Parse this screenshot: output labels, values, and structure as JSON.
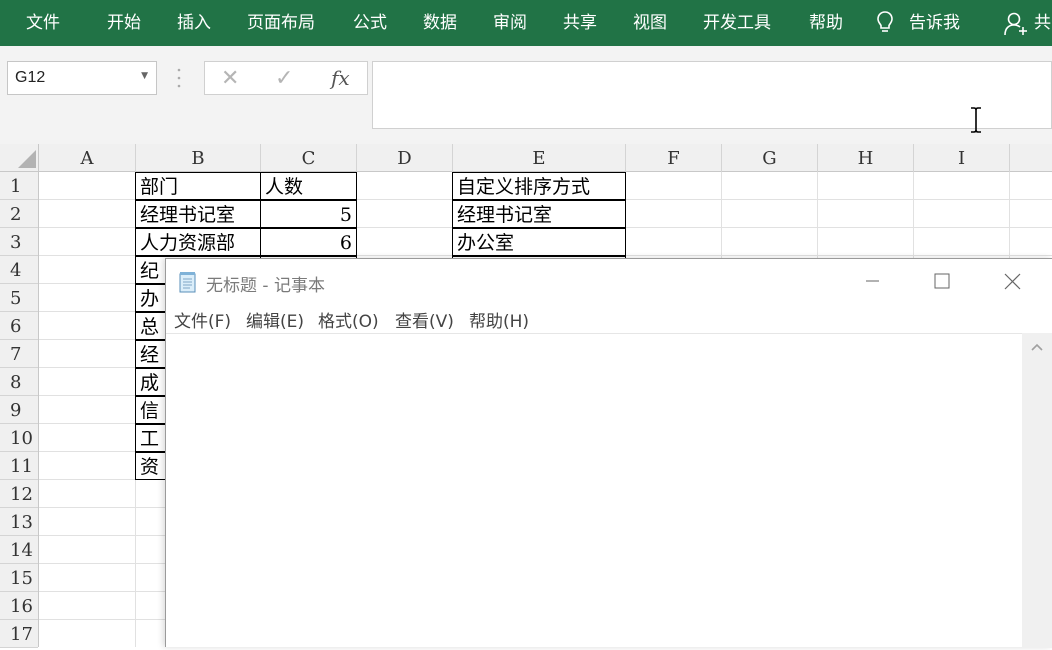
{
  "ribbon": {
    "tabs": [
      "文件",
      "开始",
      "插入",
      "页面布局",
      "公式",
      "数据",
      "审阅",
      "共享",
      "视图",
      "开发工具",
      "帮助"
    ],
    "tell_me": "告诉我",
    "share": "共"
  },
  "formula_bar": {
    "name_box": "G12",
    "fx_label": "fx",
    "cancel_symbol": "✕",
    "enter_symbol": "✓",
    "formula_value": ""
  },
  "grid": {
    "columns": [
      "A",
      "B",
      "C",
      "D",
      "E",
      "F",
      "G",
      "H",
      "I"
    ],
    "rows": [
      "1",
      "2",
      "3",
      "4",
      "5",
      "6",
      "7",
      "8",
      "9",
      "10",
      "11",
      "12",
      "13",
      "14",
      "15",
      "16",
      "17"
    ],
    "B": [
      "部门",
      "经理书记室",
      "人力资源部",
      "纪",
      "办",
      "总",
      "经",
      "成",
      "信",
      "工",
      "资"
    ],
    "C": [
      "人数",
      "5",
      "6"
    ],
    "E": [
      "自定义排序方式",
      "经理书记室",
      "办公室"
    ]
  },
  "notepad": {
    "title": "无标题 - 记事本",
    "menus": [
      "文件(F)",
      "编辑(E)",
      "格式(O)",
      "查看(V)",
      "帮助(H)"
    ],
    "content": ""
  }
}
